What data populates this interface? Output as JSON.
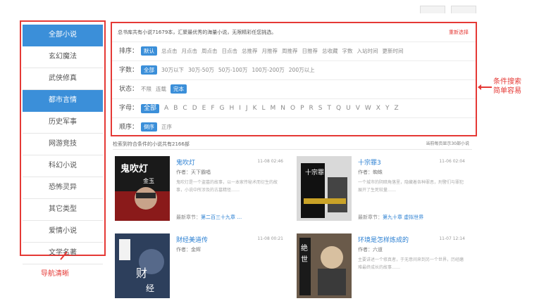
{
  "sidebar": {
    "items": [
      {
        "label": "全部小说",
        "active": true
      },
      {
        "label": "玄幻魔法",
        "active": false
      },
      {
        "label": "武侠修真",
        "active": false
      },
      {
        "label": "都市言情",
        "active": true
      },
      {
        "label": "历史军事",
        "active": false
      },
      {
        "label": "网游竞技",
        "active": false
      },
      {
        "label": "科幻小说",
        "active": false
      },
      {
        "label": "恐怖灵异",
        "active": false
      },
      {
        "label": "其它类型",
        "active": false
      },
      {
        "label": "爱情小说",
        "active": false
      },
      {
        "label": "文学名著",
        "active": false
      }
    ],
    "caption": "导航清晰"
  },
  "filter": {
    "intro": "总书库共有小说71679本，汇聚最优秀的海量小说，无限精彩任您挑选。",
    "reset": "重新选择",
    "sort": {
      "label": "排序：",
      "options": [
        "默认",
        "总点击",
        "月点击",
        "周点击",
        "日点击",
        "总推荐",
        "月推荐",
        "周推荐",
        "日推荐",
        "总收藏",
        "字数",
        "入站时间",
        "更新时间"
      ]
    },
    "words": {
      "label": "字数：",
      "options": [
        "全部",
        "30万以下",
        "30万-50万",
        "50万-100万",
        "100万-200万",
        "200万以上"
      ]
    },
    "status": {
      "label": "状态：",
      "options": [
        "不限",
        "连载",
        "完本"
      ]
    },
    "letters": {
      "label": "字母：",
      "options": [
        "全部",
        "A",
        "B",
        "C",
        "D",
        "E",
        "F",
        "G",
        "H",
        "I",
        "J",
        "K",
        "L",
        "M",
        "N",
        "O",
        "P",
        "R",
        "S",
        "T",
        "Q",
        "U",
        "V",
        "W",
        "X",
        "Y",
        "Z"
      ]
    },
    "order": {
      "label": "顺序：",
      "options": [
        "倒序",
        "正序"
      ]
    },
    "caption_line1": "条件搜索",
    "caption_line2": "简单容易"
  },
  "results": {
    "summary": "检索到符合条件的小说共有2166部",
    "per_page": "当前每页显示30部小说",
    "books": [
      {
        "title": "鬼吹灯",
        "date": "11-08 02:46",
        "author": "作者：天下霸唱",
        "desc": "鬼吹灯是一个盗墓的故事，以一本家传秘术而衍生的故事，小说中所涉及的古墓精怪……",
        "latest_label": "最新章节：",
        "latest": "第二百三十九章 …",
        "cover_title": "鬼吹灯",
        "cover_sub": "金玉"
      },
      {
        "title": "十宗罪3",
        "date": "11-06 02:04",
        "author": "作者：蜘蛛",
        "desc": "一个城市的阴暗角落里，隐藏着各种罪恶，刑警们与罪犯展开了生死较量……",
        "latest_label": "最新章节：",
        "latest": "第九十章 虚拟世界",
        "cover_title": "十宗罪",
        "cover_sub": ""
      },
      {
        "title": "财经美道传",
        "date": "11-08 00:21",
        "author": "作者：金辉",
        "desc": "",
        "latest_label": "",
        "latest": "",
        "cover_title": "财",
        "cover_sub": "经"
      },
      {
        "title": "环境是怎样炼成的",
        "date": "11-07 12:14",
        "author": "作者：六道",
        "desc": "主要讲述一个修真者，于无意间来到另一个世界，历经磨难最终成长的故事……",
        "latest_label": "",
        "latest": "",
        "cover_title": "绝",
        "cover_sub": "世"
      }
    ]
  },
  "colors": {
    "accent": "#3b8fd9",
    "annotation": "#e53935",
    "link": "#2a7fd2"
  }
}
